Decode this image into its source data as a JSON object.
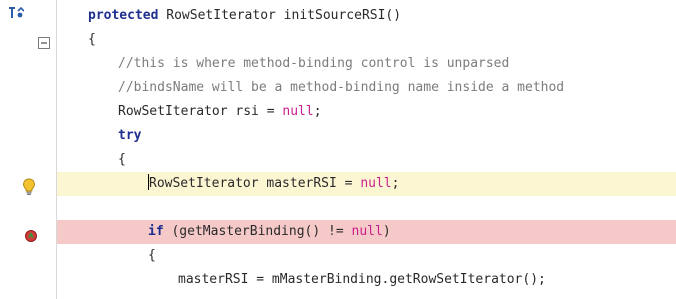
{
  "editor": {
    "lines": [
      {
        "id": "l1",
        "indent": 0,
        "parts": [
          {
            "t": "protected",
            "c": "kw"
          },
          {
            "t": " RowSetIterator initSourceRSI()",
            "c": "punc"
          }
        ]
      },
      {
        "id": "l2",
        "indent": 0,
        "parts": [
          {
            "t": "{",
            "c": "punc"
          }
        ]
      },
      {
        "id": "l3",
        "indent": 1,
        "parts": [
          {
            "t": "//this is where method-binding control is unparsed",
            "c": "cm"
          }
        ]
      },
      {
        "id": "l4",
        "indent": 1,
        "parts": [
          {
            "t": "//bindsName will be a method-binding name inside a method",
            "c": "cm"
          }
        ]
      },
      {
        "id": "l5",
        "indent": 1,
        "parts": [
          {
            "t": "RowSetIterator rsi = ",
            "c": "punc"
          },
          {
            "t": "null",
            "c": "lit"
          },
          {
            "t": ";",
            "c": "punc"
          }
        ]
      },
      {
        "id": "l6",
        "indent": 1,
        "parts": [
          {
            "t": "try",
            "c": "kw"
          }
        ]
      },
      {
        "id": "l7",
        "indent": 1,
        "parts": [
          {
            "t": "{",
            "c": "punc"
          }
        ]
      },
      {
        "id": "l8",
        "indent": 2,
        "highlight": "yellow",
        "caret": true,
        "parts": [
          {
            "t": "RowSetIterator masterRSI = ",
            "c": "punc"
          },
          {
            "t": "null",
            "c": "lit"
          },
          {
            "t": ";",
            "c": "punc"
          }
        ]
      },
      {
        "id": "l9",
        "indent": 0,
        "parts": []
      },
      {
        "id": "l10",
        "indent": 2,
        "highlight": "red",
        "parts": [
          {
            "t": "if",
            "c": "kw"
          },
          {
            "t": " (getMasterBinding() != ",
            "c": "punc"
          },
          {
            "t": "null",
            "c": "lit"
          },
          {
            "t": ")",
            "c": "punc"
          }
        ]
      },
      {
        "id": "l11",
        "indent": 2,
        "parts": [
          {
            "t": "{",
            "c": "punc"
          }
        ]
      },
      {
        "id": "l12",
        "indent": 3,
        "parts": [
          {
            "t": "masterRSI = mMasterBinding.getRowSetIterator();",
            "c": "punc"
          }
        ]
      }
    ]
  },
  "gutter": {
    "markers": [
      {
        "line": 0,
        "icon": "override-method-icon"
      },
      {
        "line": 1,
        "icon": "fold-collapse-icon"
      },
      {
        "line": 7,
        "icon": "lightbulb-hint-icon"
      },
      {
        "line": 9,
        "icon": "breakpoint-icon"
      }
    ]
  },
  "colors": {
    "keyword": "#1f2f8f",
    "comment": "#7c7c7c",
    "literal": "#c81e8c",
    "current_line": "#fdf6d3",
    "breakpoint_line": "#f6c9c9"
  }
}
